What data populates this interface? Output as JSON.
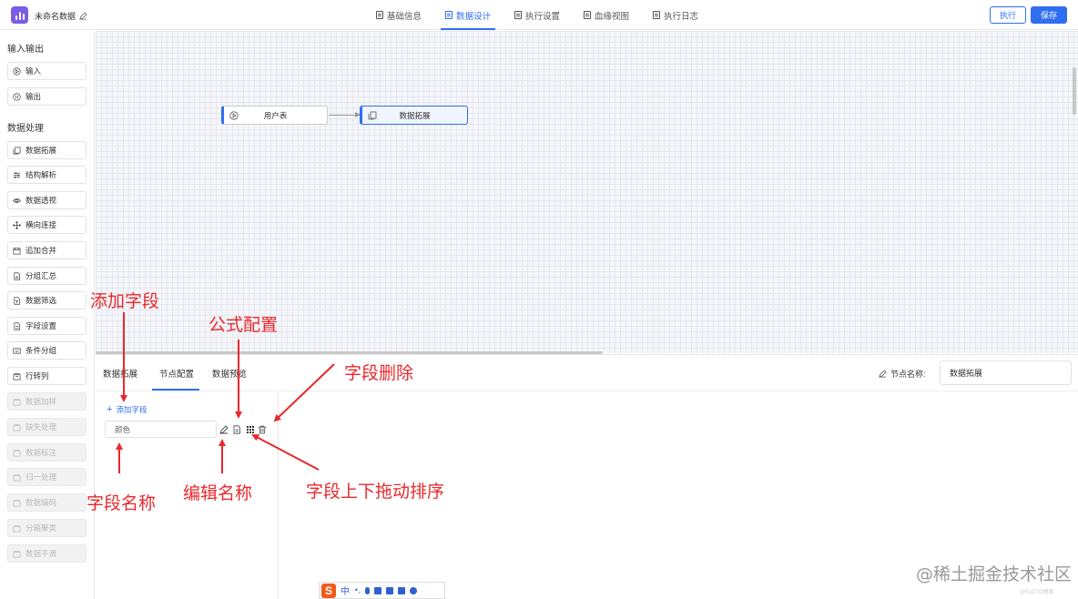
{
  "header": {
    "doc_title": "未命名数据",
    "tabs": [
      {
        "label": "基础信息"
      },
      {
        "label": "数据设计"
      },
      {
        "label": "执行设置"
      },
      {
        "label": "血缘视图"
      },
      {
        "label": "执行日志"
      }
    ],
    "active_tab": "数据设计",
    "run_label": "执行",
    "save_label": "保存",
    "colors": {
      "primary": "#2f6ff0",
      "logo": "#7b5ce6",
      "annotation": "#e8282c"
    }
  },
  "sidebar": {
    "section_io": "输入输出",
    "io_items": [
      {
        "label": "输入",
        "icon": "play-circle-icon"
      },
      {
        "label": "输出",
        "icon": "pause-circle-icon"
      }
    ],
    "section_proc": "数据处理",
    "proc_items": [
      {
        "label": "数据拓展",
        "icon": "copy-icon",
        "disabled": false
      },
      {
        "label": "结构解析",
        "icon": "sliders-icon",
        "disabled": false
      },
      {
        "label": "数据透视",
        "icon": "eye-icon",
        "disabled": false
      },
      {
        "label": "横向连接",
        "icon": "move-icon",
        "disabled": false
      },
      {
        "label": "追加合并",
        "icon": "calendar-icon",
        "disabled": false
      },
      {
        "label": "分组汇总",
        "icon": "file-chart-icon",
        "disabled": false
      },
      {
        "label": "数据筛选",
        "icon": "file-filter-icon",
        "disabled": false
      },
      {
        "label": "字段设置",
        "icon": "file-icon",
        "disabled": false
      },
      {
        "label": "条件分组",
        "icon": "keyboard-icon",
        "disabled": false
      },
      {
        "label": "行转列",
        "icon": "archive-icon",
        "disabled": false
      },
      {
        "label": "数据加样",
        "icon": "archive-icon",
        "disabled": true
      },
      {
        "label": "缺失处理",
        "icon": "archive-icon",
        "disabled": true
      },
      {
        "label": "数据标注",
        "icon": "archive-icon",
        "disabled": true
      },
      {
        "label": "归一处理",
        "icon": "archive-icon",
        "disabled": true
      },
      {
        "label": "数据编码",
        "icon": "archive-icon",
        "disabled": true
      },
      {
        "label": "分箱聚类",
        "icon": "archive-icon",
        "disabled": true
      },
      {
        "label": "数据平滑",
        "icon": "archive-icon",
        "disabled": true
      }
    ]
  },
  "canvas": {
    "nodes": [
      {
        "label": "用户表",
        "icon": "play-circle-icon"
      },
      {
        "label": "数据拓展",
        "icon": "copy-icon"
      }
    ]
  },
  "panel": {
    "tabs": [
      {
        "label": "数据拓展"
      },
      {
        "label": "节点配置"
      },
      {
        "label": "数据预览"
      }
    ],
    "active_tab": "节点配置",
    "node_name_label": "节点名称:",
    "node_name_value": "数据拓展",
    "add_field_label": "添加字段",
    "field_value": "颜色"
  },
  "annotations": {
    "add_field": "添加字段",
    "formula": "公式配置",
    "delete_field": "字段删除",
    "field_name": "字段名称",
    "edit_name": "编辑名称",
    "drag_sort": "字段上下拖动排序"
  },
  "ime": {
    "logo": "S",
    "lang": "中",
    "punct": "•,"
  },
  "watermark": {
    "text": "@稀土掘金技术社区",
    "small": "@51CTO博客"
  }
}
